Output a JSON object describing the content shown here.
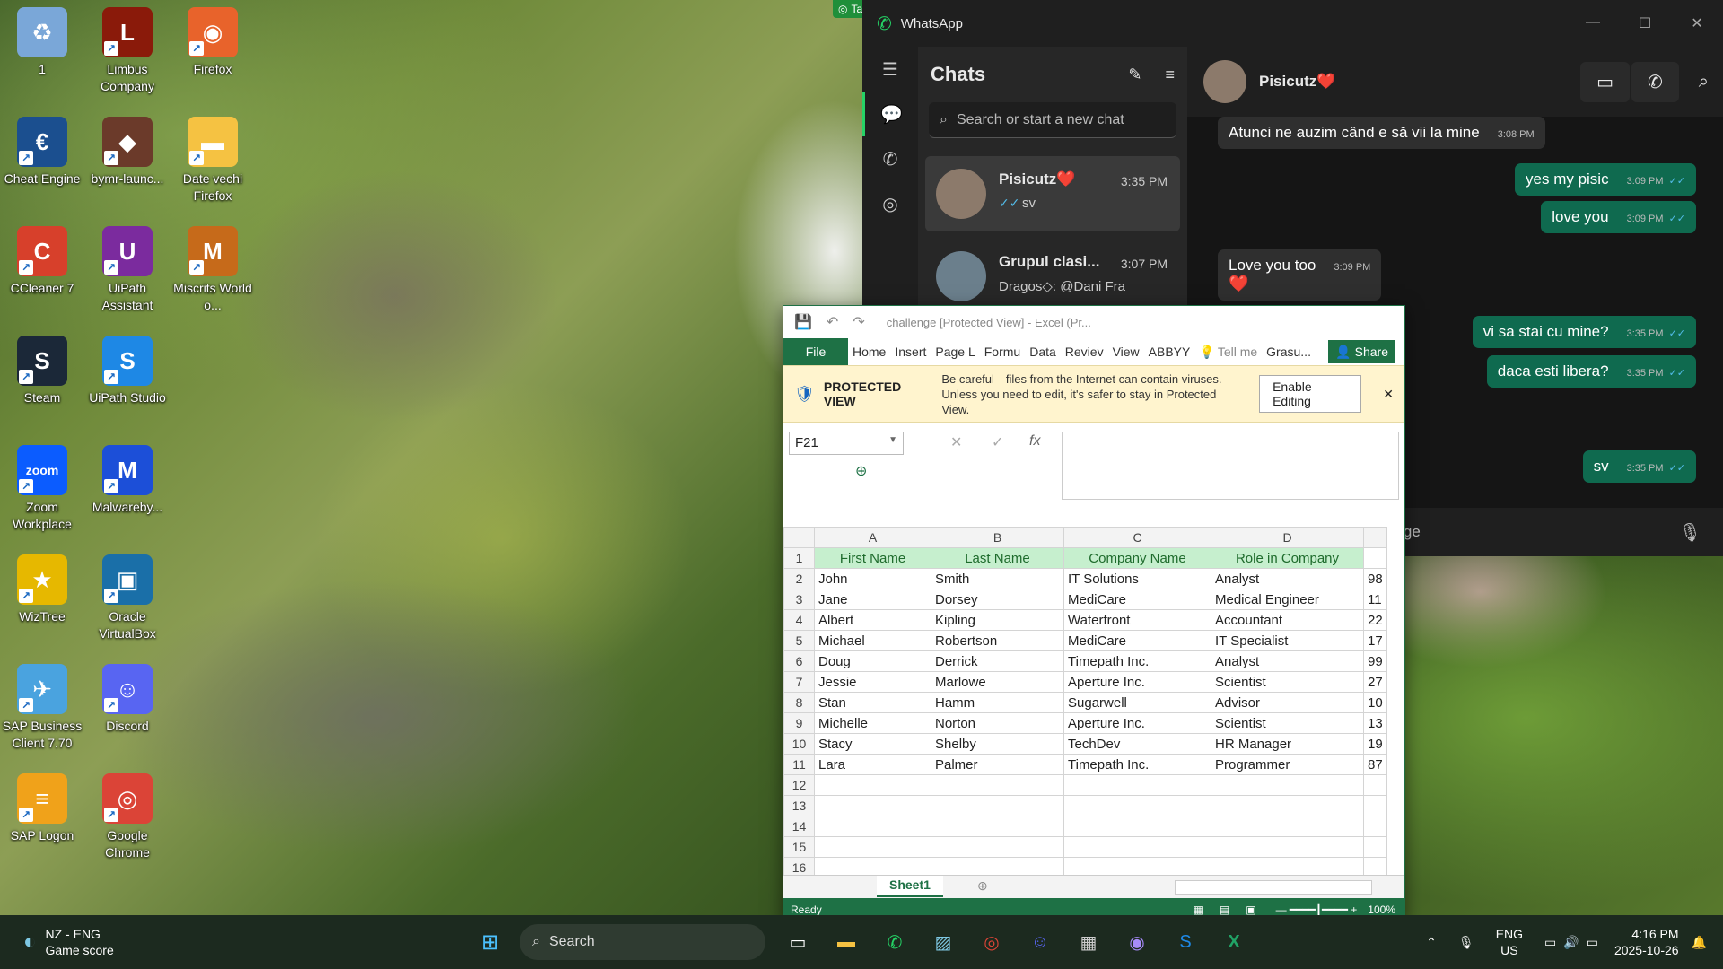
{
  "desktop": {
    "icons": [
      {
        "label": "1",
        "glyph": "♻",
        "color": "#7aa7d8"
      },
      {
        "label": "Limbus Company",
        "glyph": "L",
        "color": "#8a1a0a"
      },
      {
        "label": "Firefox",
        "glyph": "◉",
        "color": "#e8632b"
      },
      {
        "label": "Cheat Engine",
        "glyph": "€",
        "color": "#1b4f8f"
      },
      {
        "label": "bymr-launc...",
        "glyph": "◆",
        "color": "#6b3a2a"
      },
      {
        "label": "Date vechi Firefox",
        "glyph": "▬",
        "color": "#f5c242"
      },
      {
        "label": "CCleaner 7",
        "glyph": "C",
        "color": "#d7402b"
      },
      {
        "label": "UiPath Assistant",
        "glyph": "U",
        "color": "#7b2b9e"
      },
      {
        "label": "Miscrits World o...",
        "glyph": "M",
        "color": "#c66a1a"
      },
      {
        "label": "Steam",
        "glyph": "S",
        "color": "#1b2838"
      },
      {
        "label": "UiPath Studio",
        "glyph": "S",
        "color": "#1e88e5"
      },
      {
        "label": "Zoom Workplace",
        "glyph": "zoom",
        "color": "#0b5cff"
      },
      {
        "label": "Malwareby...",
        "glyph": "M",
        "color": "#1c4fd8"
      },
      {
        "label": "WizTree",
        "glyph": "★",
        "color": "#e6b800"
      },
      {
        "label": "Oracle VirtualBox",
        "glyph": "▣",
        "color": "#1a6fa8"
      },
      {
        "label": "SAP Business Client 7.70",
        "glyph": "✈",
        "color": "#4aa3df"
      },
      {
        "label": "Discord",
        "glyph": "☺",
        "color": "#5865f2"
      },
      {
        "label": "SAP Logon",
        "glyph": "≡",
        "color": "#f0a21a"
      },
      {
        "label": "Google Chrome",
        "glyph": "◎",
        "color": "#db4437"
      }
    ]
  },
  "target_badge": "Target",
  "whatsapp": {
    "title": "WhatsApp",
    "chats_heading": "Chats",
    "search_placeholder": "Search or start a new chat",
    "chats": [
      {
        "name": "Pisicutz❤️",
        "time": "3:35 PM",
        "preview": "sv"
      },
      {
        "name": "Grupul clasi...",
        "time": "3:07 PM",
        "preview": "Dragos◇: @Dani Fra"
      }
    ],
    "contact": "Pisicutz❤️",
    "messages": [
      {
        "dir": "in",
        "text": "Atunci ne auzim când e să vii la mine",
        "time": "3:08 PM"
      },
      {
        "dir": "out",
        "text": "yes my pisic",
        "time": "3:09 PM"
      },
      {
        "dir": "out",
        "text": "love you",
        "time": "3:09 PM"
      },
      {
        "dir": "in",
        "text": "Love you too",
        "time": "3:09 PM"
      },
      {
        "dir": "out",
        "text": "vi sa stai cu mine?",
        "time": "3:35 PM"
      },
      {
        "dir": "out",
        "text": "daca esti libera?",
        "time": "3:35 PM"
      },
      {
        "dir": "out",
        "text": "sv",
        "time": "3:35 PM"
      }
    ],
    "heart": "❤️",
    "composer_text": "essage"
  },
  "excel": {
    "title": "challenge  [Protected View] - Excel (Pr...",
    "tabs": [
      "Home",
      "Insert",
      "Page L",
      "Formu",
      "Data",
      "Reviev",
      "View",
      "ABBYY"
    ],
    "file_tab": "File",
    "tell_me": "Tell me",
    "user": "Grasu...",
    "share": "Share",
    "protected_label": "PROTECTED VIEW",
    "protected_msg": "Be careful—files from the Internet can contain viruses. Unless you need to edit, it's safer to stay in Protected View.",
    "enable_editing": "Enable Editing",
    "name_box": "F21",
    "fx": "fx",
    "columns": [
      "A",
      "B",
      "C",
      "D"
    ],
    "headers": [
      "First Name",
      "Last Name",
      "Company Name",
      "Role in Company"
    ],
    "rows": [
      [
        "John",
        "Smith",
        "IT Solutions",
        "Analyst",
        "98"
      ],
      [
        "Jane",
        "Dorsey",
        "MediCare",
        "Medical Engineer",
        "11"
      ],
      [
        "Albert",
        "Kipling",
        "Waterfront",
        "Accountant",
        "22"
      ],
      [
        "Michael",
        "Robertson",
        "MediCare",
        "IT Specialist",
        "17"
      ],
      [
        "Doug",
        "Derrick",
        "Timepath Inc.",
        "Analyst",
        "99"
      ],
      [
        "Jessie",
        "Marlowe",
        "Aperture Inc.",
        "Scientist",
        "27"
      ],
      [
        "Stan",
        "Hamm",
        "Sugarwell",
        "Advisor",
        "10"
      ],
      [
        "Michelle",
        "Norton",
        "Aperture Inc.",
        "Scientist",
        "13"
      ],
      [
        "Stacy",
        "Shelby",
        "TechDev",
        "HR Manager",
        "19"
      ],
      [
        "Lara",
        "Palmer",
        "Timepath Inc.",
        "Programmer",
        "87"
      ]
    ],
    "row_numbers": [
      "1",
      "2",
      "3",
      "4",
      "5",
      "6",
      "7",
      "8",
      "9",
      "10",
      "11",
      "12",
      "13",
      "14",
      "15",
      "16"
    ],
    "sheet_tab": "Sheet1",
    "status": "Ready",
    "zoom": "100%"
  },
  "taskbar": {
    "weather_line1": "NZ - ENG",
    "weather_line2": "Game score",
    "search": "Search",
    "lang1": "ENG",
    "lang2": "US",
    "time": "4:16 PM",
    "date": "2025-10-26"
  }
}
